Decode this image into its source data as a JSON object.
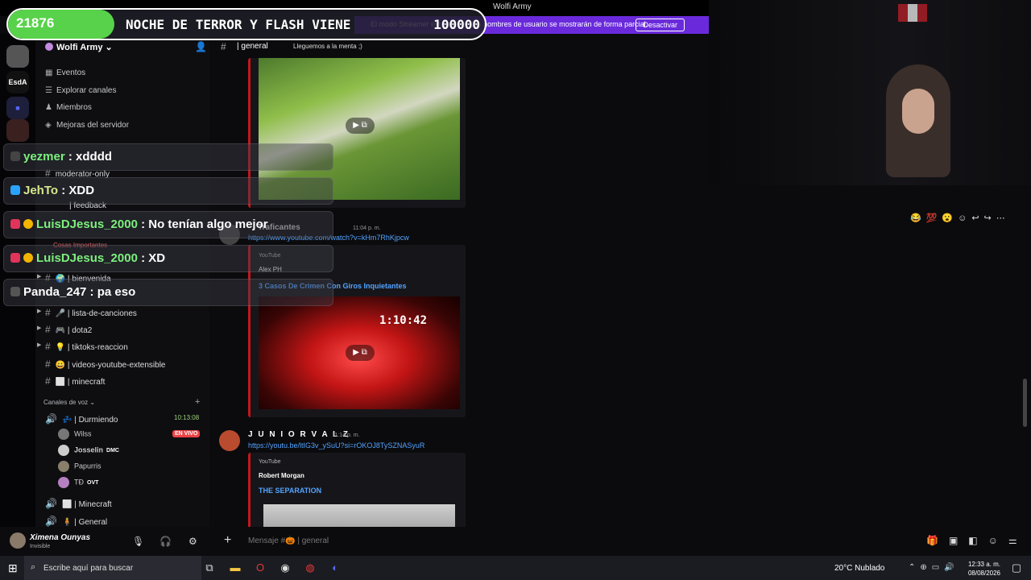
{
  "window": {
    "title": "Wolfi Army"
  },
  "streamer_bar": {
    "text": "El modo Streamer está activo. Los nombres de usuario se mostrarán de forma parcial.",
    "button": "Desactivar"
  },
  "alert": {
    "left_count": "21876",
    "message": "NOCHE DE TERROR Y FLASH VIENE",
    "right_count": "100000"
  },
  "rail": {
    "labels": [
      "EsdA"
    ]
  },
  "sidebar": {
    "server_name": "Wolfi Army",
    "nav": [
      {
        "label": "Eventos",
        "icon": "calendar-icon"
      },
      {
        "label": "Explorar canales",
        "icon": "list-icon"
      },
      {
        "label": "Miembros",
        "icon": "members-icon"
      },
      {
        "label": "Mejoras del servidor",
        "icon": "boost-icon"
      }
    ],
    "channels_top": [
      {
        "label": "moderator-only"
      },
      {
        "label": "| feedback"
      }
    ],
    "category_important": "Cosas Importantes",
    "channels": [
      {
        "label": "| bienvenida"
      },
      {
        "label": "| lista-de-canciones"
      },
      {
        "label": "| dota2"
      },
      {
        "label": "| tiktoks-reaccion"
      },
      {
        "label": "| videos-youtube-extensible"
      },
      {
        "label": "| minecraft"
      }
    ],
    "voice_category": "Canales de voz",
    "voice_channel": {
      "label": "| Durmiendo",
      "timer": "10:13:08"
    },
    "voice_users": [
      {
        "name": "Wilss",
        "tag": "",
        "live": "EN VIVO"
      },
      {
        "name": "Josselin",
        "tag": "DMC",
        "live": ""
      },
      {
        "name": "Papurris",
        "tag": "",
        "live": ""
      },
      {
        "name": "TĐ",
        "tag": "OVT",
        "live": ""
      }
    ],
    "voice_channels_more": [
      {
        "label": "| Minecraft"
      },
      {
        "label": "| General"
      }
    ]
  },
  "user_panel": {
    "name": "Ximena Ounyas",
    "status": "Invisible"
  },
  "chat_header": {
    "channel": "| general",
    "topic": "Lleguemos a la menta ;)"
  },
  "messages": {
    "msg1": {
      "author": "Traficantes",
      "time": "11:04 p. m.",
      "link": "https://www.youtube.com/watch?v=kHm7RhKjpcw",
      "provider": "YouTube",
      "channel": "Alex PH",
      "title": "3 Casos De Crimen Con Giros Inquietantes",
      "duration": "1:10:42"
    },
    "msg2": {
      "author": "J U N I O R V A L Z",
      "time": "11:14 p. m.",
      "link": "https://youtu.be/ltIG3v_ySuU?si=rOKOJ8TySZNASyuR",
      "provider": "YouTube",
      "channel": "Robert Morgan",
      "title": "THE SEPARATION"
    }
  },
  "composer": {
    "placeholder": "Mensaje #🎃 | general"
  },
  "overlay": [
    {
      "user": "yezmer",
      "text": " : xdddd"
    },
    {
      "user": "JehTo",
      "text": " : XDD"
    },
    {
      "user": "LuisDJesus_2000",
      "text": " : No tenían algo mejor"
    },
    {
      "user": "LuisDJesus_2000",
      "text": " : XD"
    },
    {
      "user": "Panda_247",
      "text": " : pa eso"
    }
  ],
  "taskbar": {
    "search": "Escribe aquí para buscar",
    "weather": "20°C  Nublado",
    "time": "12:33 a. m.",
    "date": "08/08/2026"
  }
}
